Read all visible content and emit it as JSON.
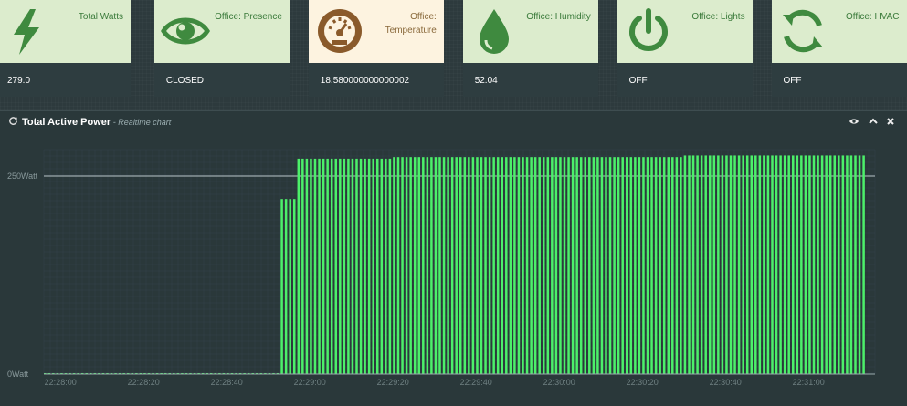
{
  "tiles": [
    {
      "title": "Total Watts",
      "value": "279.0",
      "icon": "lightning-icon",
      "style": "green"
    },
    {
      "title": "Office: Presence",
      "value": "CLOSED",
      "icon": "eye-icon",
      "style": "green"
    },
    {
      "title": "Office:\nTemperature",
      "value": "18.580000000000002",
      "icon": "gauge-icon",
      "style": "tan"
    },
    {
      "title": "Office: Humidity",
      "value": "52.04",
      "icon": "droplet-icon",
      "style": "green"
    },
    {
      "title": "Office: Lights",
      "value": "OFF",
      "icon": "power-icon",
      "style": "green"
    },
    {
      "title": "Office: HVAC",
      "value": "OFF",
      "icon": "refresh-cycle-icon",
      "style": "green"
    }
  ],
  "colors": {
    "accent_green": "#3f8a3f",
    "accent_tan": "#8a5a2b",
    "bar": "#4cf06a"
  },
  "panel": {
    "title": "Total Active Power",
    "subtitle": " - Realtime chart",
    "controls": [
      "eye-icon",
      "chevron-up-icon",
      "close-icon"
    ]
  },
  "chart_data": {
    "type": "bar",
    "title": "Total Active Power",
    "ylabel_ticks": [
      "0Watt",
      "250Watt"
    ],
    "y_tick_values": [
      0,
      250
    ],
    "ylim": [
      0,
      300
    ],
    "xlabel_ticks": [
      "22:28:00",
      "22:28:20",
      "22:28:40",
      "22:29:00",
      "22:29:20",
      "22:29:40",
      "22:30:00",
      "22:30:20",
      "22:30:40",
      "22:31:00"
    ],
    "xlim_seconds_from": "22:27:56",
    "segments": [
      {
        "from": "22:27:56",
        "to": "22:28:53",
        "value": 0
      },
      {
        "from": "22:28:53",
        "to": "22:28:57",
        "value": 221
      },
      {
        "from": "22:28:57",
        "to": "22:29:20",
        "value": 272
      },
      {
        "from": "22:29:20",
        "to": "22:30:30",
        "value": 274
      },
      {
        "from": "22:30:30",
        "to": "22:31:14",
        "value": 276
      }
    ],
    "bar_interval_seconds": 1,
    "grid": true
  }
}
